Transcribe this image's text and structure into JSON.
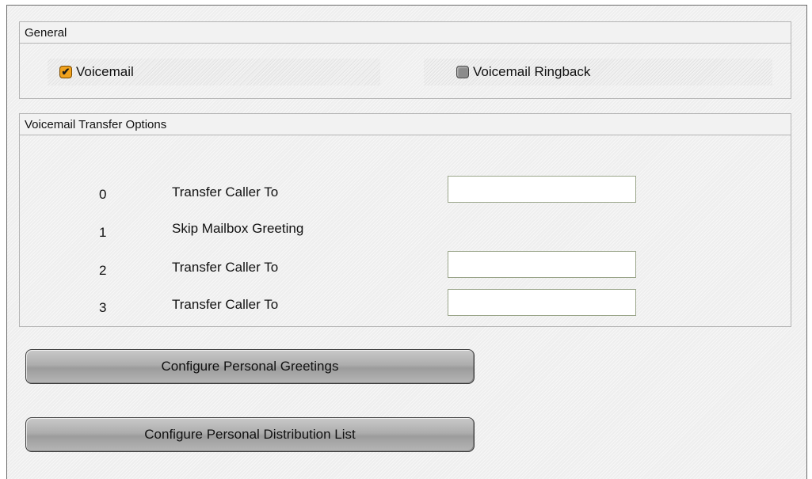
{
  "general": {
    "title": "General",
    "voicemail": {
      "label": "Voicemail",
      "checked": true
    },
    "ringback": {
      "label": "Voicemail Ringback",
      "checked": false
    }
  },
  "transfer_options": {
    "title": "Voicemail Transfer Options",
    "rows": [
      {
        "key": "0",
        "label": "Transfer Caller To",
        "has_input": true,
        "value": ""
      },
      {
        "key": "1",
        "label": "Skip Mailbox Greeting",
        "has_input": false
      },
      {
        "key": "2",
        "label": "Transfer Caller To",
        "has_input": true,
        "value": ""
      },
      {
        "key": "3",
        "label": "Transfer Caller To",
        "has_input": true,
        "value": ""
      }
    ]
  },
  "buttons": {
    "greetings": "Configure Personal Greetings",
    "distribution": "Configure Personal Distribution List"
  },
  "colors": {
    "checkbox_checked": "#f0a21e",
    "checkbox_unchecked": "#8b8b8b"
  },
  "icons": {
    "checked": "checkmark-icon"
  }
}
